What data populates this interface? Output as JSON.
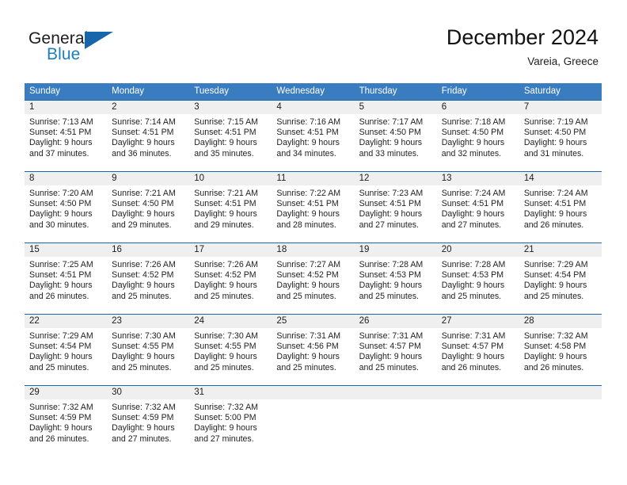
{
  "brand": {
    "name_part1": "General",
    "name_part2": "Blue",
    "accent_color": "#1a7fc1",
    "triangle_color": "#1766ab"
  },
  "header": {
    "title": "December 2024",
    "subtitle": "Vareia, Greece"
  },
  "theme": {
    "header_row_bg": "#3a7cc0",
    "daynum_row_bg": "#efefef",
    "row_divider": "#1a66ab"
  },
  "weekdays": [
    "Sunday",
    "Monday",
    "Tuesday",
    "Wednesday",
    "Thursday",
    "Friday",
    "Saturday"
  ],
  "weeks": [
    {
      "days": [
        {
          "num": "1",
          "sunrise": "Sunrise: 7:13 AM",
          "sunset": "Sunset: 4:51 PM",
          "daylight1": "Daylight: 9 hours",
          "daylight2": "and 37 minutes."
        },
        {
          "num": "2",
          "sunrise": "Sunrise: 7:14 AM",
          "sunset": "Sunset: 4:51 PM",
          "daylight1": "Daylight: 9 hours",
          "daylight2": "and 36 minutes."
        },
        {
          "num": "3",
          "sunrise": "Sunrise: 7:15 AM",
          "sunset": "Sunset: 4:51 PM",
          "daylight1": "Daylight: 9 hours",
          "daylight2": "and 35 minutes."
        },
        {
          "num": "4",
          "sunrise": "Sunrise: 7:16 AM",
          "sunset": "Sunset: 4:51 PM",
          "daylight1": "Daylight: 9 hours",
          "daylight2": "and 34 minutes."
        },
        {
          "num": "5",
          "sunrise": "Sunrise: 7:17 AM",
          "sunset": "Sunset: 4:50 PM",
          "daylight1": "Daylight: 9 hours",
          "daylight2": "and 33 minutes."
        },
        {
          "num": "6",
          "sunrise": "Sunrise: 7:18 AM",
          "sunset": "Sunset: 4:50 PM",
          "daylight1": "Daylight: 9 hours",
          "daylight2": "and 32 minutes."
        },
        {
          "num": "7",
          "sunrise": "Sunrise: 7:19 AM",
          "sunset": "Sunset: 4:50 PM",
          "daylight1": "Daylight: 9 hours",
          "daylight2": "and 31 minutes."
        }
      ]
    },
    {
      "days": [
        {
          "num": "8",
          "sunrise": "Sunrise: 7:20 AM",
          "sunset": "Sunset: 4:50 PM",
          "daylight1": "Daylight: 9 hours",
          "daylight2": "and 30 minutes."
        },
        {
          "num": "9",
          "sunrise": "Sunrise: 7:21 AM",
          "sunset": "Sunset: 4:50 PM",
          "daylight1": "Daylight: 9 hours",
          "daylight2": "and 29 minutes."
        },
        {
          "num": "10",
          "sunrise": "Sunrise: 7:21 AM",
          "sunset": "Sunset: 4:51 PM",
          "daylight1": "Daylight: 9 hours",
          "daylight2": "and 29 minutes."
        },
        {
          "num": "11",
          "sunrise": "Sunrise: 7:22 AM",
          "sunset": "Sunset: 4:51 PM",
          "daylight1": "Daylight: 9 hours",
          "daylight2": "and 28 minutes."
        },
        {
          "num": "12",
          "sunrise": "Sunrise: 7:23 AM",
          "sunset": "Sunset: 4:51 PM",
          "daylight1": "Daylight: 9 hours",
          "daylight2": "and 27 minutes."
        },
        {
          "num": "13",
          "sunrise": "Sunrise: 7:24 AM",
          "sunset": "Sunset: 4:51 PM",
          "daylight1": "Daylight: 9 hours",
          "daylight2": "and 27 minutes."
        },
        {
          "num": "14",
          "sunrise": "Sunrise: 7:24 AM",
          "sunset": "Sunset: 4:51 PM",
          "daylight1": "Daylight: 9 hours",
          "daylight2": "and 26 minutes."
        }
      ]
    },
    {
      "days": [
        {
          "num": "15",
          "sunrise": "Sunrise: 7:25 AM",
          "sunset": "Sunset: 4:51 PM",
          "daylight1": "Daylight: 9 hours",
          "daylight2": "and 26 minutes."
        },
        {
          "num": "16",
          "sunrise": "Sunrise: 7:26 AM",
          "sunset": "Sunset: 4:52 PM",
          "daylight1": "Daylight: 9 hours",
          "daylight2": "and 25 minutes."
        },
        {
          "num": "17",
          "sunrise": "Sunrise: 7:26 AM",
          "sunset": "Sunset: 4:52 PM",
          "daylight1": "Daylight: 9 hours",
          "daylight2": "and 25 minutes."
        },
        {
          "num": "18",
          "sunrise": "Sunrise: 7:27 AM",
          "sunset": "Sunset: 4:52 PM",
          "daylight1": "Daylight: 9 hours",
          "daylight2": "and 25 minutes."
        },
        {
          "num": "19",
          "sunrise": "Sunrise: 7:28 AM",
          "sunset": "Sunset: 4:53 PM",
          "daylight1": "Daylight: 9 hours",
          "daylight2": "and 25 minutes."
        },
        {
          "num": "20",
          "sunrise": "Sunrise: 7:28 AM",
          "sunset": "Sunset: 4:53 PM",
          "daylight1": "Daylight: 9 hours",
          "daylight2": "and 25 minutes."
        },
        {
          "num": "21",
          "sunrise": "Sunrise: 7:29 AM",
          "sunset": "Sunset: 4:54 PM",
          "daylight1": "Daylight: 9 hours",
          "daylight2": "and 25 minutes."
        }
      ]
    },
    {
      "days": [
        {
          "num": "22",
          "sunrise": "Sunrise: 7:29 AM",
          "sunset": "Sunset: 4:54 PM",
          "daylight1": "Daylight: 9 hours",
          "daylight2": "and 25 minutes."
        },
        {
          "num": "23",
          "sunrise": "Sunrise: 7:30 AM",
          "sunset": "Sunset: 4:55 PM",
          "daylight1": "Daylight: 9 hours",
          "daylight2": "and 25 minutes."
        },
        {
          "num": "24",
          "sunrise": "Sunrise: 7:30 AM",
          "sunset": "Sunset: 4:55 PM",
          "daylight1": "Daylight: 9 hours",
          "daylight2": "and 25 minutes."
        },
        {
          "num": "25",
          "sunrise": "Sunrise: 7:31 AM",
          "sunset": "Sunset: 4:56 PM",
          "daylight1": "Daylight: 9 hours",
          "daylight2": "and 25 minutes."
        },
        {
          "num": "26",
          "sunrise": "Sunrise: 7:31 AM",
          "sunset": "Sunset: 4:57 PM",
          "daylight1": "Daylight: 9 hours",
          "daylight2": "and 25 minutes."
        },
        {
          "num": "27",
          "sunrise": "Sunrise: 7:31 AM",
          "sunset": "Sunset: 4:57 PM",
          "daylight1": "Daylight: 9 hours",
          "daylight2": "and 26 minutes."
        },
        {
          "num": "28",
          "sunrise": "Sunrise: 7:32 AM",
          "sunset": "Sunset: 4:58 PM",
          "daylight1": "Daylight: 9 hours",
          "daylight2": "and 26 minutes."
        }
      ]
    },
    {
      "days": [
        {
          "num": "29",
          "sunrise": "Sunrise: 7:32 AM",
          "sunset": "Sunset: 4:59 PM",
          "daylight1": "Daylight: 9 hours",
          "daylight2": "and 26 minutes."
        },
        {
          "num": "30",
          "sunrise": "Sunrise: 7:32 AM",
          "sunset": "Sunset: 4:59 PM",
          "daylight1": "Daylight: 9 hours",
          "daylight2": "and 27 minutes."
        },
        {
          "num": "31",
          "sunrise": "Sunrise: 7:32 AM",
          "sunset": "Sunset: 5:00 PM",
          "daylight1": "Daylight: 9 hours",
          "daylight2": "and 27 minutes."
        },
        {
          "num": "",
          "sunrise": "",
          "sunset": "",
          "daylight1": "",
          "daylight2": ""
        },
        {
          "num": "",
          "sunrise": "",
          "sunset": "",
          "daylight1": "",
          "daylight2": ""
        },
        {
          "num": "",
          "sunrise": "",
          "sunset": "",
          "daylight1": "",
          "daylight2": ""
        },
        {
          "num": "",
          "sunrise": "",
          "sunset": "",
          "daylight1": "",
          "daylight2": ""
        }
      ]
    }
  ]
}
